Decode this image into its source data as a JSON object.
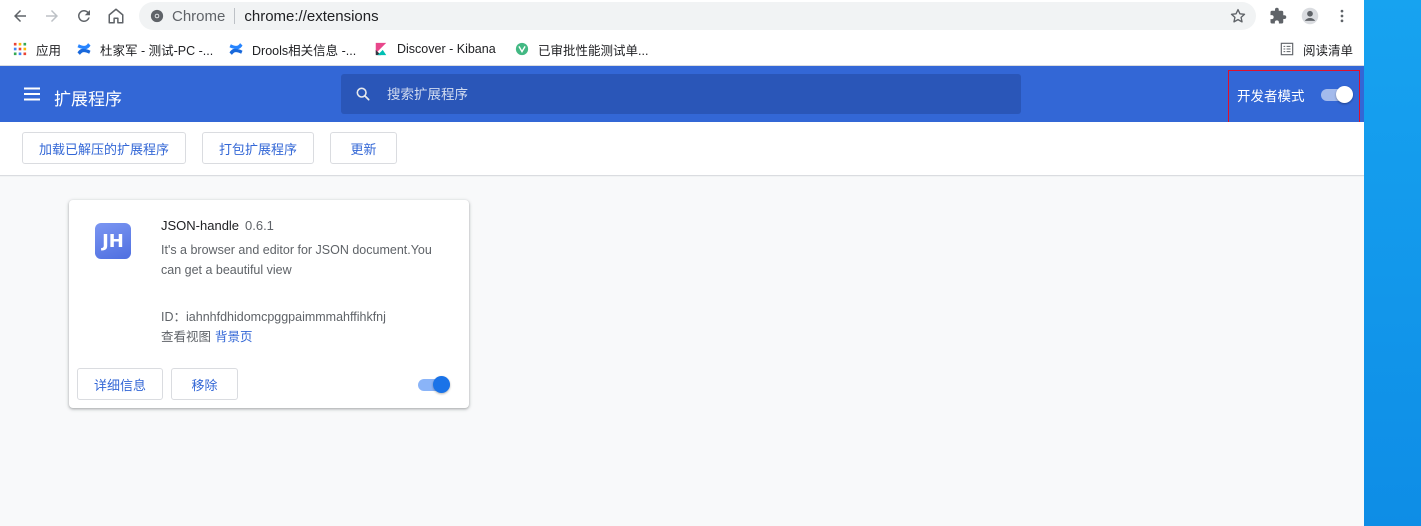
{
  "toolbar": {
    "site_label": "Chrome",
    "url": "chrome://extensions",
    "icons": [
      "back-icon",
      "forward-icon",
      "reload-icon",
      "home-icon",
      "secure-info-icon",
      "bookmark-star-icon",
      "extensions-puzzle-icon",
      "profile-avatar-icon",
      "menu-kebab-icon"
    ]
  },
  "bookmarks": {
    "items": [
      {
        "label": "应用"
      },
      {
        "label": "杜家军 - 测试-PC -..."
      },
      {
        "label": "Drools相关信息 -..."
      },
      {
        "label": "Discover - Kibana"
      },
      {
        "label": "已审批性能测试单..."
      }
    ],
    "reading_list": "阅读清单"
  },
  "header": {
    "title": "扩展程序",
    "search_placeholder": "搜索扩展程序",
    "dev_mode_label": "开发者模式",
    "dev_mode_on": true
  },
  "dev_bar": {
    "load_unpacked": "加载已解压的扩展程序",
    "pack": "打包扩展程序",
    "update": "更新"
  },
  "extension": {
    "icon_text": "JH",
    "name": "JSON-handle",
    "version": "0.6.1",
    "description": "It's a browser and editor for JSON document.You can get a beautiful view",
    "id_label": "ID：",
    "id": "iahnhfdhidomcpggpaimmmahffihkfnj",
    "views_label": "查看视图",
    "views_link": "背景页",
    "details_button": "详细信息",
    "remove_button": "移除",
    "enabled": true
  },
  "colors": {
    "header_blue": "#3367d6",
    "link_blue": "#3367d6",
    "toggle_blue": "#1a73e8",
    "highlight_red": "#e0102a"
  }
}
